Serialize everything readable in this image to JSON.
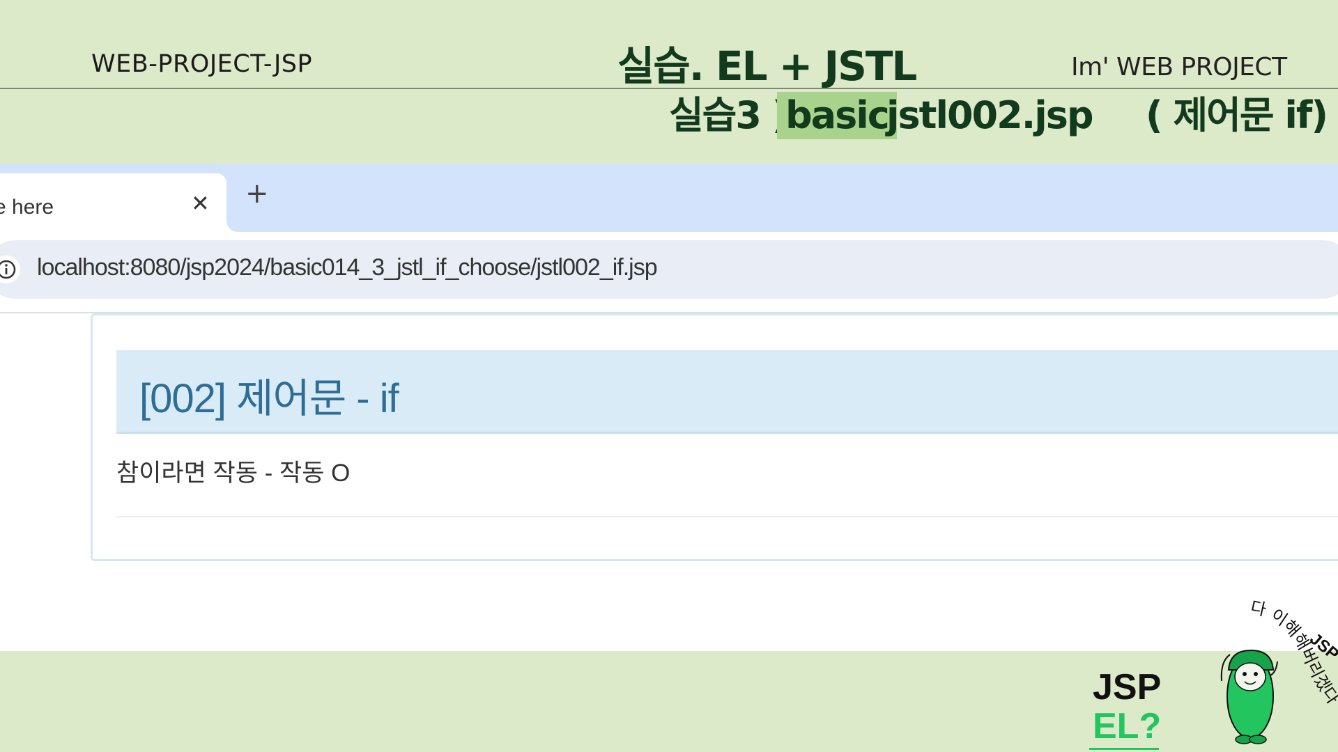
{
  "slide": {
    "project_label": "WEB-PROJECT-JSP",
    "title": "실습. EL + JSTL",
    "brand": "Im'  WEB PROJECT",
    "subtitle": {
      "prefix": "실습3 )",
      "highlight": "basic",
      "file": "jstl002.jsp",
      "topic": "( 제어문 if)"
    }
  },
  "browser": {
    "tab": {
      "title": "e here",
      "close_glyph": "✕"
    },
    "new_tab_glyph": "+",
    "address_bar": {
      "url": "localhost:8080/jsp2024/basic014_3_jstl_if_choose/jstl002_if.jsp",
      "icon": "info-icon"
    }
  },
  "page": {
    "heading": "[002] 제어문 - if",
    "result_text": "참이라면 작동 - 작동 O"
  },
  "mascot": {
    "jsp_label": "JSP",
    "el_label": "EL?",
    "speech": "다 이해해버리겠다~!",
    "badge": "JSP"
  },
  "colors": {
    "slide_bg": "#ddeac9",
    "title_green": "#123a1c",
    "highlight": "#a9d28c",
    "tab_strip": "#d3e3fb",
    "panel_heading_bg": "#d9ebf6",
    "panel_heading_text": "#2e6d95",
    "mascot_green": "#22c55e"
  }
}
